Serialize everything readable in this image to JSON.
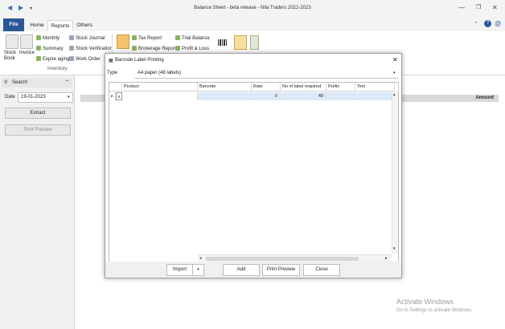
{
  "window": {
    "title": "Balance Sheet - beta release - Nila Traders 2022-2023"
  },
  "tabs": [
    {
      "label": "File"
    },
    {
      "label": "Home"
    },
    {
      "label": "Reports"
    },
    {
      "label": "Others"
    }
  ],
  "ribbon": {
    "inventory": {
      "stock_book": "Stock Book",
      "invoice": "Invoice",
      "monthly": "Monthly",
      "summary": "Summary",
      "expire_aging": "Expire aging",
      "stock_journal": "Stock Journal",
      "stock_verification": "Stock Verification",
      "work_order": "Work Order",
      "group_label": "Inventory"
    },
    "accounts": {
      "tax_report": "Tax Report",
      "brokerage_report": "Brokerage Report",
      "trial_balance": "Trial Balance",
      "profit_loss": "Profit & Loss"
    }
  },
  "left_panel": {
    "search_label": "Search",
    "date_label": "Date",
    "date_value": "19-01-2023",
    "extract_label": "Extract",
    "print_preview_label": "Print Preview"
  },
  "main": {
    "amount_header": "Amount"
  },
  "dialog": {
    "title": "Barcode Label Printing",
    "type_label": "Type",
    "type_value": "A4 paper (48 labels)",
    "columns": {
      "product": "Product",
      "barcode": "Barcode",
      "rate": "Rate",
      "no_of_label": "No of label required",
      "prefix": "Prefix",
      "text": "Text"
    },
    "row": {
      "delete": "x",
      "rate": "0",
      "labels": "48"
    },
    "buttons": {
      "import": "Import",
      "add": "Add",
      "print_preview": "Print Preview",
      "close": "Close"
    }
  },
  "watermark": {
    "line1": "Activate Windows",
    "line2": "Go to Settings to activate Windows."
  }
}
